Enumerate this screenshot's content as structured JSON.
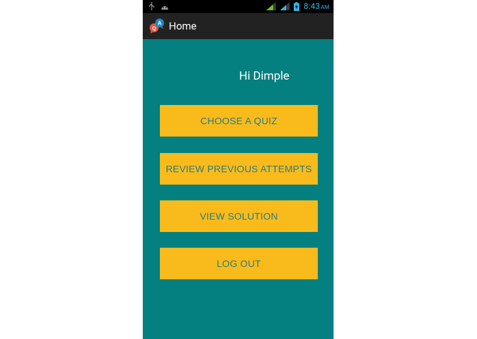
{
  "status_bar": {
    "time": "8:43",
    "ampm": "AM",
    "icons": [
      "usb-icon",
      "android-debug-icon",
      "signal-icon",
      "signal-icon",
      "battery-charging-icon"
    ]
  },
  "action_bar": {
    "title": "Home",
    "app_icon": "qa-chat-bubbles-icon",
    "app_icon_letters": {
      "a": "A",
      "q": "Q"
    }
  },
  "main": {
    "greeting": "Hi Dimple",
    "buttons": [
      {
        "label": "CHOOSE A QUIZ"
      },
      {
        "label": "REVIEW PREVIOUS ATTEMPTS"
      },
      {
        "label": "VIEW SOLUTION"
      },
      {
        "label": "LOG OUT"
      }
    ]
  },
  "colors": {
    "background": "#048080",
    "button": "#f9bb1c",
    "button_text": "#2b7b7a",
    "action_bar": "#222222",
    "status_accent": "#33b5e5"
  }
}
